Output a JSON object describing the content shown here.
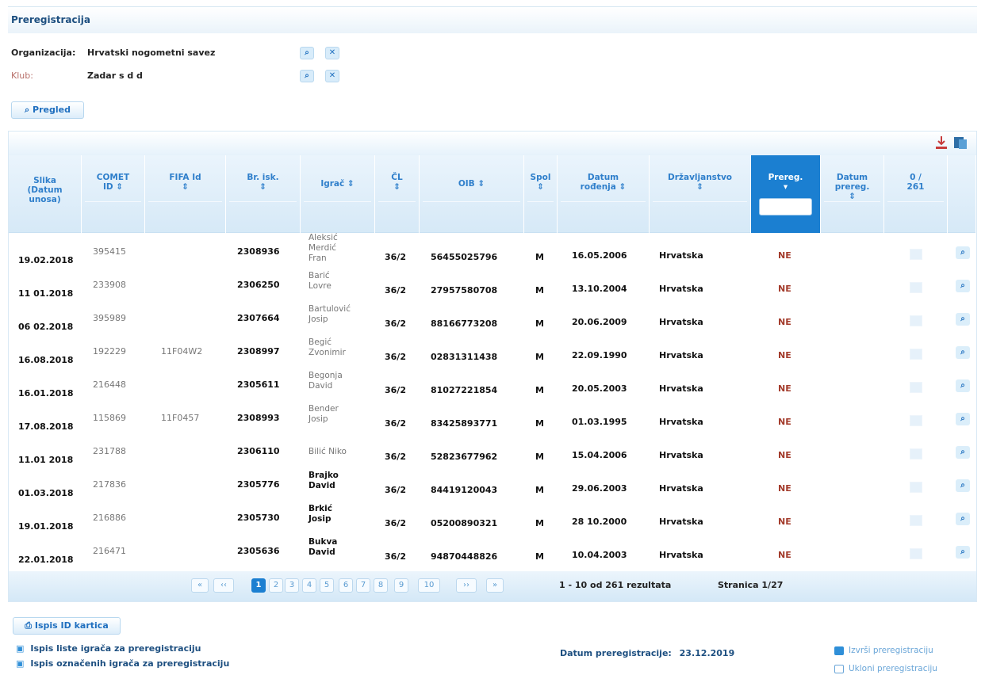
{
  "page": {
    "title": "Preregistracija"
  },
  "filters": {
    "organizacija_label": "Organizacija:",
    "organizacija_value": "Hrvatski nogometni savez",
    "klub_label": "Klub:",
    "klub_value": "Zadar s d d",
    "pregled_label": "Pregled"
  },
  "table": {
    "columns": [
      {
        "line1": "Slika",
        "line2": "(Datum",
        "line3": "unosa)"
      },
      {
        "line1": "COMET",
        "line2": "ID ⇕",
        "line3": ""
      },
      {
        "line1": "FIFA Id",
        "line2": "⇕",
        "line3": ""
      },
      {
        "line1": "Br. isk.",
        "line2": "⇕",
        "line3": ""
      },
      {
        "line1": "Igrač ⇕",
        "line2": "",
        "line3": ""
      },
      {
        "line1": "ČL",
        "line2": "⇕",
        "line3": ""
      },
      {
        "line1": "OIB ⇕",
        "line2": "",
        "line3": ""
      },
      {
        "line1": "Spol",
        "line2": "⇕",
        "line3": ""
      },
      {
        "line1": "Datum",
        "line2": "rođenja ⇕",
        "line3": ""
      },
      {
        "line1": "Državljanstvo",
        "line2": "⇕",
        "line3": ""
      },
      {
        "line1": "Prereg.",
        "line2": "▾",
        "line3": ""
      },
      {
        "line1": "Datum",
        "line2": "prereg.",
        "line3": "⇕"
      },
      {
        "line1": "0 /",
        "line2": "261",
        "line3": ""
      },
      {
        "line1": "",
        "line2": "",
        "line3": ""
      }
    ],
    "rows": [
      {
        "datum": "19.02.2018",
        "comet": "395415",
        "fifa": "",
        "brisk": "2308936",
        "igrac": [
          "Aleksić",
          "Merdić",
          "Fran"
        ],
        "dark": false,
        "cl": "36/2",
        "oib": "56455025796",
        "spol": "M",
        "rodenje": "16.05.2006",
        "drz": "Hrvatska",
        "prereg": "NE"
      },
      {
        "datum": "11 01.2018",
        "comet": "233908",
        "fifa": "",
        "brisk": "2306250",
        "igrac": [
          "Barić",
          "Lovre"
        ],
        "dark": false,
        "cl": "36/2",
        "oib": "27957580708",
        "spol": "M",
        "rodenje": "13.10.2004",
        "drz": "Hrvatska",
        "prereg": "NE"
      },
      {
        "datum": "06 02.2018",
        "comet": "395989",
        "fifa": "",
        "brisk": "2307664",
        "igrac": [
          "Bartulović",
          "Josip"
        ],
        "dark": false,
        "cl": "36/2",
        "oib": "88166773208",
        "spol": "M",
        "rodenje": "20.06.2009",
        "drz": "Hrvatska",
        "prereg": "NE"
      },
      {
        "datum": "16.08.2018",
        "comet": "192229",
        "fifa": "11F04W2",
        "brisk": "2308997",
        "igrac": [
          "Begić",
          "Zvonimir"
        ],
        "dark": false,
        "cl": "36/2",
        "oib": "02831311438",
        "spol": "M",
        "rodenje": "22.09.1990",
        "drz": "Hrvatska",
        "prereg": "NE"
      },
      {
        "datum": "16.01.2018",
        "comet": "216448",
        "fifa": "",
        "brisk": "2305611",
        "igrac": [
          "Begonja",
          "David"
        ],
        "dark": false,
        "cl": "36/2",
        "oib": "81027221854",
        "spol": "M",
        "rodenje": "20.05.2003",
        "drz": "Hrvatska",
        "prereg": "NE"
      },
      {
        "datum": "17.08.2018",
        "comet": "115869",
        "fifa": "11F0457",
        "brisk": "2308993",
        "igrac": [
          "Bender",
          "Josip"
        ],
        "dark": false,
        "cl": "36/2",
        "oib": "83425893771",
        "spol": "M",
        "rodenje": "01.03.1995",
        "drz": "Hrvatska",
        "prereg": "NE"
      },
      {
        "datum": "11.01 2018",
        "comet": "231788",
        "fifa": "",
        "brisk": "2306110",
        "igrac": [
          "Bilić Niko"
        ],
        "dark": false,
        "cl": "36/2",
        "oib": "52823677962",
        "spol": "M",
        "rodenje": "15.04.2006",
        "drz": "Hrvatska",
        "prereg": "NE"
      },
      {
        "datum": "01.03.2018",
        "comet": "217836",
        "fifa": "",
        "brisk": "2305776",
        "igrac": [
          "Brajko",
          "David"
        ],
        "dark": true,
        "cl": "36/2",
        "oib": "84419120043",
        "spol": "M",
        "rodenje": "29.06.2003",
        "drz": "Hrvatska",
        "prereg": "NE"
      },
      {
        "datum": "19.01.2018",
        "comet": "216886",
        "fifa": "",
        "brisk": "2305730",
        "igrac": [
          "Brkić",
          "Josip"
        ],
        "dark": true,
        "cl": "36/2",
        "oib": "05200890321",
        "spol": "M",
        "rodenje": "28 10.2000",
        "drz": "Hrvatska",
        "prereg": "NE"
      },
      {
        "datum": "22.01.2018",
        "comet": "216471",
        "fifa": "",
        "brisk": "2305636",
        "igrac": [
          "Bukva",
          "David"
        ],
        "dark": true,
        "cl": "36/2",
        "oib": "94870448826",
        "spol": "M",
        "rodenje": "10.04.2003",
        "drz": "Hrvatska",
        "prereg": "NE"
      }
    ]
  },
  "pager": {
    "first": "«",
    "prev": "‹‹",
    "pages": [
      "1",
      "2",
      "3",
      "4",
      "5",
      "6",
      "7",
      "8",
      "9",
      "10"
    ],
    "next": "››",
    "last": "»",
    "summary": "1 - 10 od 261 rezultata",
    "page_info": "Stranica 1/27"
  },
  "footer": {
    "ispis_id": "Ispis ID kartica",
    "ispis_liste": "Ispis liste igrača za preregistraciju",
    "ispis_oznacenih": "Ispis označenih igrača za preregistraciju",
    "datum_label": "Datum preregistracije:",
    "datum_value": "23.12.2019",
    "izvrsi": "Izvrši preregistraciju",
    "ukloni": "Ukloni preregistraciju"
  },
  "colors": {
    "accent": "#1b7fd1",
    "header_text": "#2f7fcb",
    "ne": "#a33b2b"
  }
}
